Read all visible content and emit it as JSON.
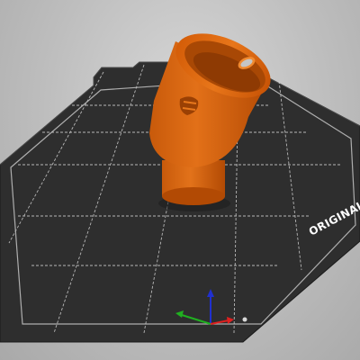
{
  "viewport": {
    "bed_label": "ORIGINAL PRUSA",
    "colors": {
      "background": "#bdbdbd",
      "bed": "#2e2e2e",
      "grid": "#cfcfcf",
      "model": "#e06a10",
      "axis_x": "#e02020",
      "axis_y": "#20b020",
      "axis_z": "#2030d0"
    },
    "icons": [
      "xyz-axis-gizmo"
    ]
  }
}
